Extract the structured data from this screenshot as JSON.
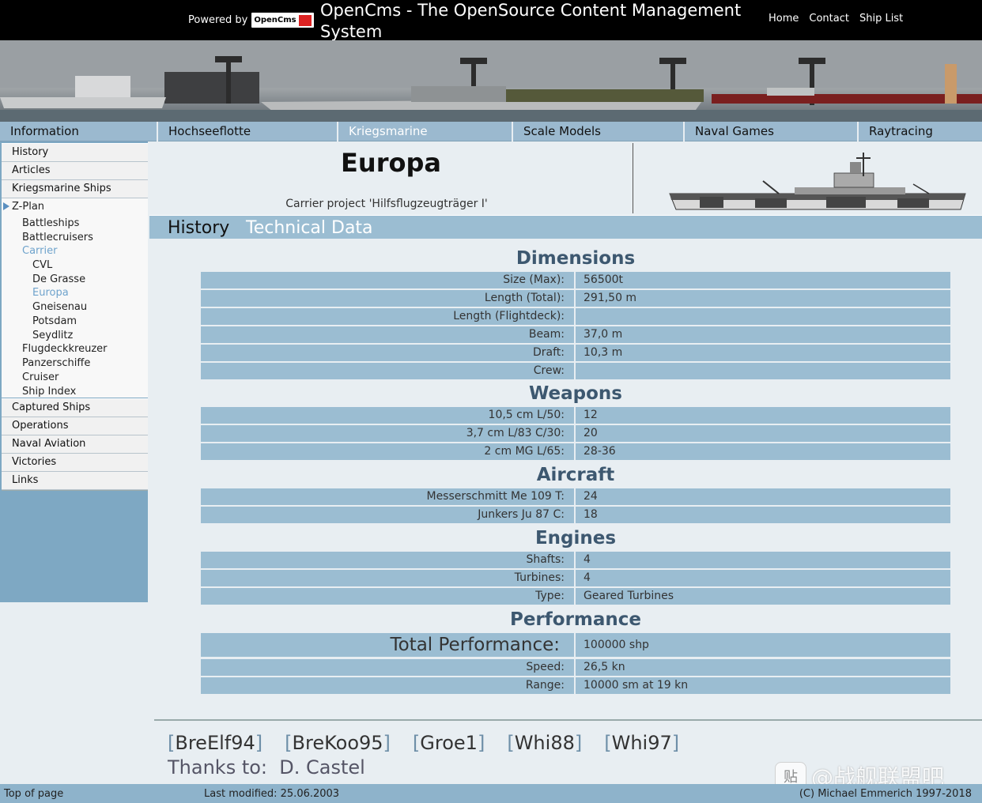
{
  "topbar": {
    "powered_by": "Powered by",
    "powered_logo_text": "OpenCms",
    "site_title": "OpenCms - The OpenSource Content Management System",
    "nav": [
      "Home",
      "Contact",
      "Ship List"
    ]
  },
  "mainnav": [
    {
      "label": "Information",
      "active": false
    },
    {
      "label": "Hochseeflotte",
      "active": false
    },
    {
      "label": "Kriegsmarine",
      "active": true
    },
    {
      "label": "Scale Models",
      "active": false
    },
    {
      "label": "Naval Games",
      "active": false
    },
    {
      "label": "Raytracing",
      "active": false
    }
  ],
  "sidebar": {
    "top_items": [
      "History",
      "Articles",
      "Kriegsmarine Ships"
    ],
    "zplan": {
      "label": "Z-Plan",
      "items": [
        {
          "label": "Battleships",
          "level": 1,
          "selected": false
        },
        {
          "label": "Battlecruisers",
          "level": 1,
          "selected": false
        },
        {
          "label": "Carrier",
          "level": 1,
          "selected": true
        },
        {
          "label": "CVL",
          "level": 2,
          "selected": false
        },
        {
          "label": "De Grasse",
          "level": 2,
          "selected": false
        },
        {
          "label": "Europa",
          "level": 2,
          "selected": true
        },
        {
          "label": "Gneisenau",
          "level": 2,
          "selected": false
        },
        {
          "label": "Potsdam",
          "level": 2,
          "selected": false
        },
        {
          "label": "Seydlitz",
          "level": 2,
          "selected": false
        },
        {
          "label": "Flugdeckkreuzer",
          "level": 1,
          "selected": false
        },
        {
          "label": "Panzerschiffe",
          "level": 1,
          "selected": false
        },
        {
          "label": "Cruiser",
          "level": 1,
          "selected": false
        },
        {
          "label": "Ship Index",
          "level": 1,
          "selected": false
        }
      ]
    },
    "bottom_items": [
      "Captured Ships",
      "Operations",
      "Naval Aviation",
      "Victories",
      "Links"
    ]
  },
  "page": {
    "title": "Europa",
    "subtitle": "Carrier project 'Hilfsflugzeugträger I'"
  },
  "subtabs": {
    "history": "History",
    "technical": "Technical Data"
  },
  "sections": [
    {
      "title": "Dimensions",
      "rows": [
        {
          "label": "Size (Max):",
          "value": "56500t"
        },
        {
          "label": "Length (Total):",
          "value": "291,50 m"
        },
        {
          "label": "Length (Flightdeck):",
          "value": ""
        },
        {
          "label": "Beam:",
          "value": "37,0 m"
        },
        {
          "label": "Draft:",
          "value": "10,3 m"
        },
        {
          "label": "Crew:",
          "value": ""
        }
      ]
    },
    {
      "title": "Weapons",
      "rows": [
        {
          "label": "10,5 cm L/50:",
          "value": "12"
        },
        {
          "label": "3,7 cm L/83 C/30:",
          "value": "20"
        },
        {
          "label": "2 cm MG L/65:",
          "value": "28-36"
        }
      ]
    },
    {
      "title": "Aircraft",
      "rows": [
        {
          "label": "Messerschmitt Me 109 T:",
          "value": "24"
        },
        {
          "label": "Junkers Ju 87 C:",
          "value": "18"
        }
      ]
    },
    {
      "title": "Engines",
      "rows": [
        {
          "label": "Shafts:",
          "value": "4"
        },
        {
          "label": "Turbines:",
          "value": "4"
        },
        {
          "label": "Type:",
          "value": "Geared Turbines"
        }
      ]
    },
    {
      "title": "Performance",
      "rows": [
        {
          "label": "Total Performance:",
          "value": "100000 shp",
          "large": true
        },
        {
          "label": "Speed:",
          "value": "26,5 kn"
        },
        {
          "label": "Range:",
          "value": "10000 sm at 19 kn"
        }
      ]
    }
  ],
  "versions": [
    "BreElf94",
    "BreKoo95",
    "Groe1",
    "Whi88",
    "Whi97"
  ],
  "thanks": {
    "label": "Thanks to:",
    "name": "D. Castel"
  },
  "statusbar": {
    "top_of_page": "Top of page",
    "last_modified": "Last modified: 25.06.2003",
    "copyright": "(C) Michael Emmerich 1997-2018"
  },
  "watermark": {
    "logo": "贴",
    "text": "@战舰联盟吧"
  }
}
